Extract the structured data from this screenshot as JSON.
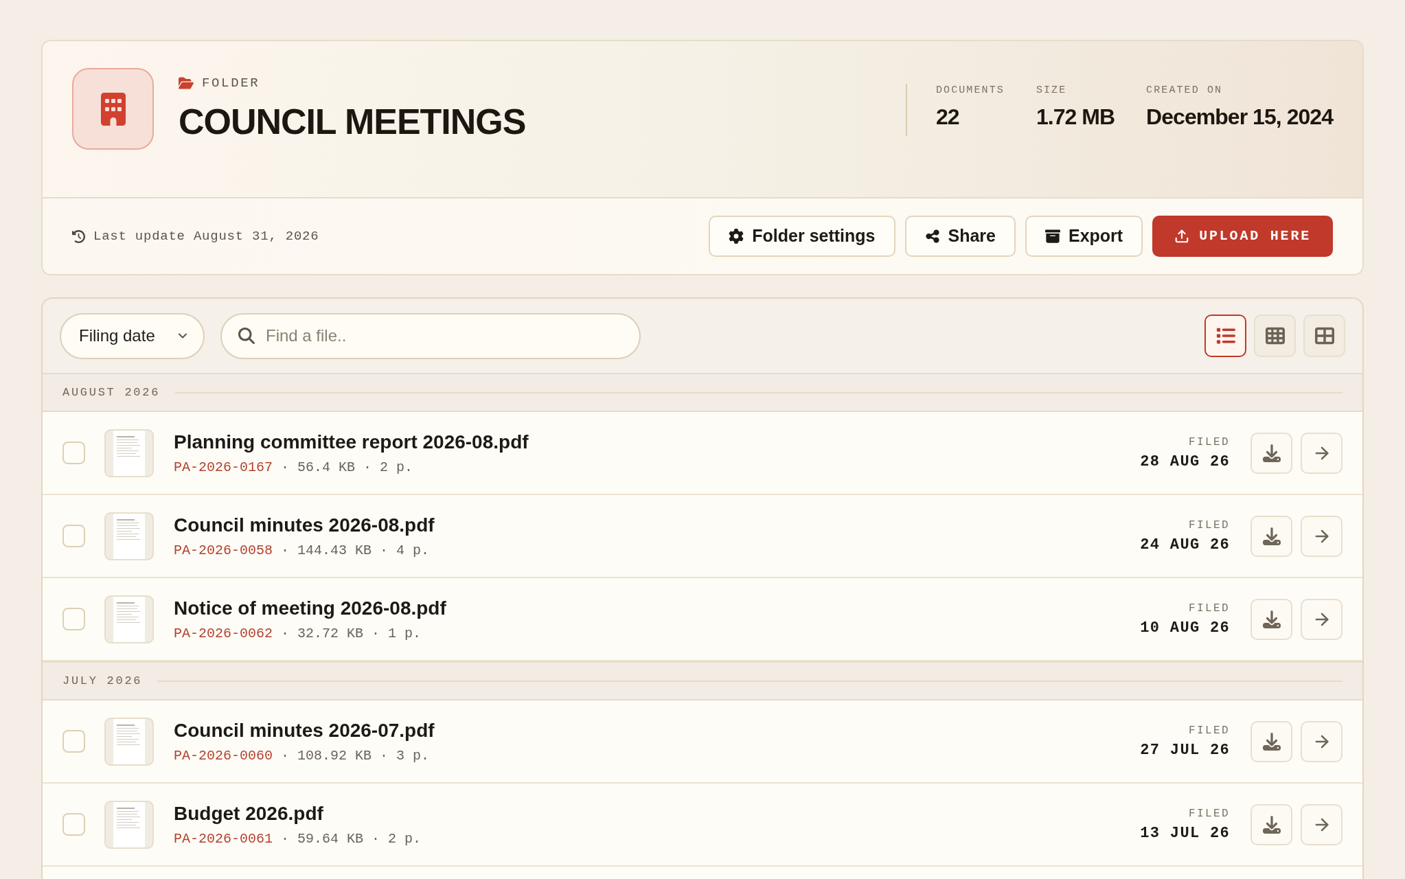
{
  "folder": {
    "type_label": "FOLDER",
    "title": "COUNCIL MEETINGS",
    "stats": [
      {
        "label": "DOCUMENTS",
        "value": "22"
      },
      {
        "label": "SIZE",
        "value": "1.72 MB"
      },
      {
        "label": "CREATED ON",
        "value": "December 15, 2024"
      }
    ],
    "last_update": "Last update August 31, 2026",
    "actions": [
      {
        "kind": "settings",
        "label": "Folder settings"
      },
      {
        "kind": "share",
        "label": "Share"
      },
      {
        "kind": "export",
        "label": "Export"
      },
      {
        "kind": "upload",
        "label": "UPLOAD HERE"
      }
    ]
  },
  "toolbar": {
    "sort": {
      "value": "Filing date"
    },
    "search": {
      "placeholder": "Find a file.."
    },
    "view_modes": [
      {
        "kind": "list",
        "selected": true
      },
      {
        "kind": "grid",
        "selected": false
      },
      {
        "kind": "tiles",
        "selected": false
      }
    ]
  },
  "groups": [
    {
      "label": "AUGUST 2026",
      "files": [
        {
          "name": "Planning committee report 2026-08.pdf",
          "ref": "PA-2026-0167",
          "details": "· 56.4 KB · 2 p.",
          "filed_label": "FILED",
          "filed_date": "28 AUG 26",
          "checked": false
        },
        {
          "name": "Council minutes 2026-08.pdf",
          "ref": "PA-2026-0058",
          "details": "· 144.43 KB · 4 p.",
          "filed_label": "FILED",
          "filed_date": "24 AUG 26",
          "checked": false
        },
        {
          "name": "Notice of meeting 2026-08.pdf",
          "ref": "PA-2026-0062",
          "details": "· 32.72 KB · 1 p.",
          "filed_label": "FILED",
          "filed_date": "10 AUG 26",
          "checked": false
        }
      ]
    },
    {
      "label": "JULY 2026",
      "files": [
        {
          "name": "Council minutes 2026-07.pdf",
          "ref": "PA-2026-0060",
          "details": "· 108.92 KB · 3 p.",
          "filed_label": "FILED",
          "filed_date": "27 JUL 26",
          "checked": false
        },
        {
          "name": "Budget 2026.pdf",
          "ref": "PA-2026-0061",
          "details": "· 59.64 KB · 2 p.",
          "filed_label": "FILED",
          "filed_date": "13 JUL 26",
          "checked": false
        }
      ]
    }
  ]
}
